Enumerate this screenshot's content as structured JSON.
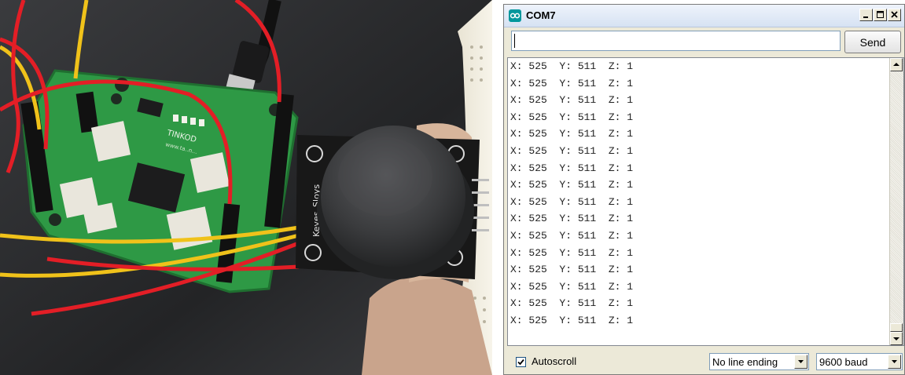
{
  "photo": {
    "board_silkscreen": "TINKOD",
    "board_silkscreen_sub": "www.ta..n...",
    "module_label": "Keyes_SJoys"
  },
  "window": {
    "title": "COM7",
    "icon": "arduino-infinity-icon",
    "controls": {
      "minimize": "_",
      "maximize": "□",
      "close": "×"
    }
  },
  "input": {
    "value": "",
    "placeholder": ""
  },
  "send_label": "Send",
  "output": {
    "lines": [
      "X: 525  Y: 511  Z: 1",
      "X: 525  Y: 511  Z: 1",
      "X: 525  Y: 511  Z: 1",
      "X: 525  Y: 511  Z: 1",
      "X: 525  Y: 511  Z: 1",
      "X: 525  Y: 511  Z: 1",
      "X: 525  Y: 511  Z: 1",
      "X: 525  Y: 511  Z: 1",
      "X: 525  Y: 511  Z: 1",
      "X: 525  Y: 511  Z: 1",
      "X: 525  Y: 511  Z: 1",
      "X: 525  Y: 511  Z: 1",
      "X: 525  Y: 511  Z: 1",
      "X: 525  Y: 511  Z: 1",
      "X: 525  Y: 511  Z: 1",
      "X: 525  Y: 511  Z: 1"
    ]
  },
  "autoscroll": {
    "label": "Autoscroll",
    "checked": true
  },
  "line_ending": {
    "selected": "No line ending"
  },
  "baud": {
    "selected": "9600 baud"
  },
  "colors": {
    "title_text": "#000000",
    "arduino_teal": "#00979c",
    "board_green": "#2f9a45"
  }
}
